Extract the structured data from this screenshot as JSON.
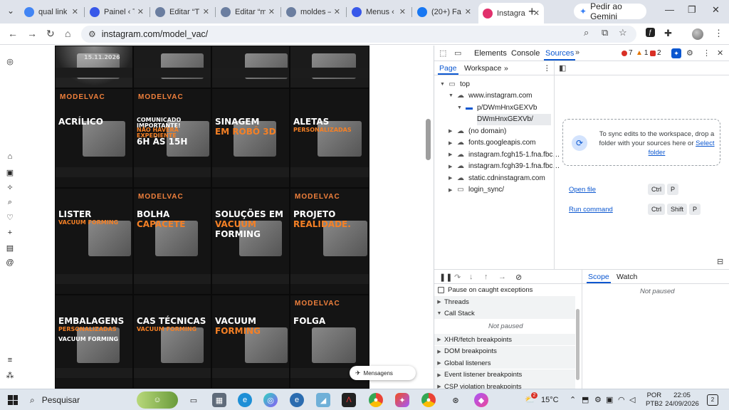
{
  "browser": {
    "tabs": [
      {
        "title": "qual link",
        "color": "#4285f4"
      },
      {
        "title": "Painel ‹ T",
        "color": "#3858e9"
      },
      {
        "title": "Editar “T",
        "color": "#6b7ea0"
      },
      {
        "title": "Editar “m",
        "color": "#6b7ea0"
      },
      {
        "title": "moldes –",
        "color": "#6b7ea0"
      },
      {
        "title": "Menus ‹",
        "color": "#3858e9"
      },
      {
        "title": "(20+) Fa",
        "color": "#1877f2"
      },
      {
        "title": "Instagra",
        "color": "#e1306c"
      }
    ],
    "new_tab": "+",
    "gemini_label": "Pedir ao Gemini",
    "url": "instagram.com/model_vac/"
  },
  "instagram": {
    "rail_icons": [
      "instagram-icon",
      "home-icon",
      "reels-icon",
      "explore-icon",
      "search-icon",
      "notifications-icon",
      "create-icon",
      "profile-icon",
      "threads-icon",
      "menu-icon",
      "more-icon"
    ],
    "tiles": [
      {
        "lines": [],
        "date": "15.11.2026"
      },
      {
        "lines": [],
        "date": ""
      },
      {
        "lines": [],
        "date": ""
      },
      {
        "lines": [],
        "date": ""
      },
      {
        "lines": [
          "ACRÍLICO"
        ],
        "logo": "MODELVAC"
      },
      {
        "lines": [
          "COMUNICADO IMPORTANTE!",
          "NÃO HAVERÁ EXPEDIENTE",
          "6h às 15h"
        ],
        "logo": "MODELVAC"
      },
      {
        "lines": [
          "SINAGEM",
          "EM ROBÔ 3D"
        ],
        "logo": ""
      },
      {
        "lines": [
          "ALETAS",
          "PERSONALIZADAS"
        ],
        "logo": ""
      },
      {
        "lines": [
          "LISTER",
          "VACUUM FORMING"
        ],
        "logo": ""
      },
      {
        "lines": [
          "BOLHA",
          "CAPACETE"
        ],
        "logo": "MODELVAC"
      },
      {
        "lines": [
          "SOLUÇÕES EM",
          "VACUUM",
          "FORMING"
        ],
        "logo": ""
      },
      {
        "lines": [
          "PROJETO",
          "REALIDADE."
        ],
        "logo": "MODELVAC"
      },
      {
        "lines": [
          "EMBALAGENS",
          "PERSONALIZADAS",
          "VACUUM FORMING"
        ],
        "logo": ""
      },
      {
        "lines": [
          "CAS TÉCNICAS",
          "VACUUM FORMING"
        ],
        "logo": ""
      },
      {
        "lines": [
          "VACUUM",
          "FORMING"
        ],
        "logo": ""
      },
      {
        "lines": [
          "Folga"
        ],
        "logo": "MODELVAC"
      }
    ],
    "messages_label": "Mensagens"
  },
  "devtools": {
    "tabs": [
      "Elements",
      "Console",
      "Sources"
    ],
    "active_tab": "Sources",
    "errors": "7",
    "warnings": "1",
    "issues": "2",
    "sub_tabs": [
      "Page",
      "Workspace"
    ],
    "tree": [
      {
        "label": "top",
        "depth": 0,
        "arrow": "▼",
        "icon": "frame-icon"
      },
      {
        "label": "www.instagram.com",
        "depth": 1,
        "arrow": "▼",
        "icon": "cloud-icon"
      },
      {
        "label": "p/DWmHnxGEXVb",
        "depth": 2,
        "arrow": "▼",
        "icon": "folder-icon"
      },
      {
        "label": "DWmHnxGEXVb/",
        "depth": 3,
        "arrow": "",
        "icon": "file-icon"
      },
      {
        "label": "(no domain)",
        "depth": 1,
        "arrow": "▶",
        "icon": "cloud-icon"
      },
      {
        "label": "fonts.googleapis.com",
        "depth": 1,
        "arrow": "▶",
        "icon": "cloud-icon"
      },
      {
        "label": "instagram.fcgh15-1.fna.fbc…",
        "depth": 1,
        "arrow": "▶",
        "icon": "cloud-icon"
      },
      {
        "label": "instagram.fcgh39-1.fna.fbc…",
        "depth": 1,
        "arrow": "▶",
        "icon": "cloud-icon"
      },
      {
        "label": "static.cdninstagram.com",
        "depth": 1,
        "arrow": "▶",
        "icon": "cloud-icon"
      },
      {
        "label": "login_sync/",
        "depth": 1,
        "arrow": "▶",
        "icon": "frame-icon"
      }
    ],
    "workspace_text": "To sync edits to the workspace, drop a folder with your sources here or",
    "select_folder": "Select folder",
    "open_file": "Open file",
    "run_command": "Run command",
    "keys_open": [
      "Ctrl",
      "P"
    ],
    "keys_run": [
      "Ctrl",
      "Shift",
      "P"
    ],
    "pause_caught": "Pause on caught exceptions",
    "threads": "Threads",
    "call_stack": "Call Stack",
    "not_paused": "Not paused",
    "breakpoints": [
      "XHR/fetch breakpoints",
      "DOM breakpoints",
      "Global listeners",
      "Event listener breakpoints",
      "CSP violation breakpoints"
    ],
    "scope_tabs": [
      "Scope",
      "Watch"
    ],
    "scope_not_paused": "Not paused"
  },
  "taskbar": {
    "search": "Pesquisar",
    "weather": "15°C",
    "weather_badge": "2",
    "lang_top": "POR",
    "lang_bottom": "PTB2",
    "time": "22:05",
    "date": "24/09/2026",
    "notif_count": "2"
  }
}
